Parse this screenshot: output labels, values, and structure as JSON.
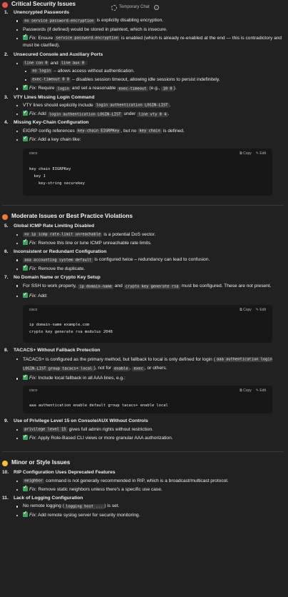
{
  "topbar": {
    "label": "Temporary Chat"
  },
  "colors": {
    "critical": "#e5534b",
    "moderate": "#f07b38",
    "minor": "#f2c230",
    "check": "#40a060"
  },
  "critical": {
    "title": "Critical Security Issues",
    "i1": {
      "num": "1.",
      "title": "Unencrypted Passwords",
      "b1_code": "no service password-encryption",
      "b1_text": " is explicitly disabling encryption.",
      "b2": "Passwords (if defined) would be stored in plaintext, which is insecure.",
      "b3_fix": "Fix:",
      "b3_t1": " Ensure ",
      "b3_code": "service password-encryption",
      "b3_t2": " is enabled (which is already re-enabled at the end — this is contradictory and must be clarified)."
    },
    "i2": {
      "num": "2.",
      "title": "Unsecured Console and Auxiliary Ports",
      "b1_code1": "line con 0",
      "b1_t1": " and ",
      "b1_code2": "line aux 0",
      "b1_t2": ":",
      "s1_code": "no login",
      "s1_text": " – allows access without authentication.",
      "s2_code": "exec-timeout 0 0",
      "s2_text": " – disables session timeout, allowing idle sessions to persist indefinitely.",
      "b2_fix": "Fix:",
      "b2_t1": " Require ",
      "b2_code1": "login",
      "b2_t2": " and set a reasonable ",
      "b2_code2": "exec-timeout",
      "b2_t3": " (e.g., ",
      "b2_code3": "10 0",
      "b2_t4": ")."
    },
    "i3": {
      "num": "3.",
      "title": "VTY Lines Missing Login Command",
      "b1_t1": "VTY lines should explicitly include ",
      "b1_code": "login authentication LOGIN-LIST",
      "b1_t2": ".",
      "b2_fix": "Fix:",
      "b2_t1": " Add ",
      "b2_code1": "login authentication LOGIN-LIST",
      "b2_t2": " under ",
      "b2_code2": "line vty 0 4",
      "b2_t3": "."
    },
    "i4": {
      "num": "4.",
      "title": "Missing Key-Chain Configuration",
      "b1_t1": "EIGRP config references ",
      "b1_code1": "key-chain EIGRPKey",
      "b1_t2": ", but no ",
      "b1_code2": "key chain",
      "b1_t3": " is defined.",
      "b2_fix": "Fix:",
      "b2_t1": " Add a key chain like:",
      "code": {
        "lang": "cisco",
        "copy": "Copy",
        "edit": "Edit",
        "body": "key chain EIGRPKey\n  key 1\n    key-string securekey"
      }
    }
  },
  "moderate": {
    "title": "Moderate Issues or Best Practice Violations",
    "i5": {
      "num": "5.",
      "title": "Global ICMP Rate Limiting Disabled",
      "b1_code": "no ip icmp rate-limit unreachable",
      "b1_text": " is a potential DoS vector.",
      "b2_fix": "Fix:",
      "b2_text": " Remove this line or tune ICMP unreachable rate limits."
    },
    "i6": {
      "num": "6.",
      "title": "Inconsistent or Redundant Configuration",
      "b1_code": "aaa accounting system default",
      "b1_text": " is configured twice – redundancy can lead to confusion.",
      "b2_fix": "Fix:",
      "b2_text": " Remove the duplicate."
    },
    "i7": {
      "num": "7.",
      "title": "No Domain Name or Crypto Key Setup",
      "b1_t1": "For SSH to work properly, ",
      "b1_code1": "ip domain-name",
      "b1_t2": " and ",
      "b1_code2": "crypto key generate rsa",
      "b1_t3": " must be configured. These are not present.",
      "b2_fix": "Fix:",
      "b2_text": " Add:",
      "code": {
        "lang": "cisco",
        "copy": "Copy",
        "edit": "Edit",
        "body": "ip domain-name example.com\ncrypto key generate rsa modulus 2048"
      }
    },
    "i8": {
      "num": "8.",
      "title": "TACACS+ Without Fallback Protection",
      "b1_t1": "TACACS+ is configured as the primary method, but fallback to local is only defined for login (",
      "b1_code1": "aaa authentication login LOGIN-LIST group tacacs+ local",
      "b1_t2": "), not for ",
      "b1_code2": "enable",
      "b1_t3": ", ",
      "b1_code3": "exec",
      "b1_t4": ", or others.",
      "b2_fix": "Fix:",
      "b2_text": " Include local fallback in all AAA lines, e.g.:",
      "code": {
        "lang": "cisco",
        "copy": "Copy",
        "edit": "Edit",
        "body": "aaa authentication enable default group tacacs+ enable local"
      }
    },
    "i9": {
      "num": "9.",
      "title": "Use of Privilege Level 15 on Console/AUX Without Controls",
      "b1_code": "privilege level 15",
      "b1_text": " gives full admin rights without restriction.",
      "b2_fix": "Fix:",
      "b2_text": " Apply Role-Based CLI views or more granular AAA authorization."
    }
  },
  "minor": {
    "title": "Minor or Style Issues",
    "i10": {
      "num": "10.",
      "title": "RIP Configuration Uses Deprecated Features",
      "b1_code": "neighbor",
      "b1_text": " command is not generally recommended in RIP, which is a broadcast/multicast protocol.",
      "b2_fix": "Fix:",
      "b2_text": " Remove static neighbors unless there's a specific use case."
    },
    "i11": {
      "num": "11.",
      "title": "Lack of Logging Configuration",
      "b1_t1": "No remote logging (",
      "b1_code": "logging host ...",
      "b1_t2": ") is set.",
      "b2_fix": "Fix:",
      "b2_text": " Add remote syslog server for security monitoring."
    }
  }
}
